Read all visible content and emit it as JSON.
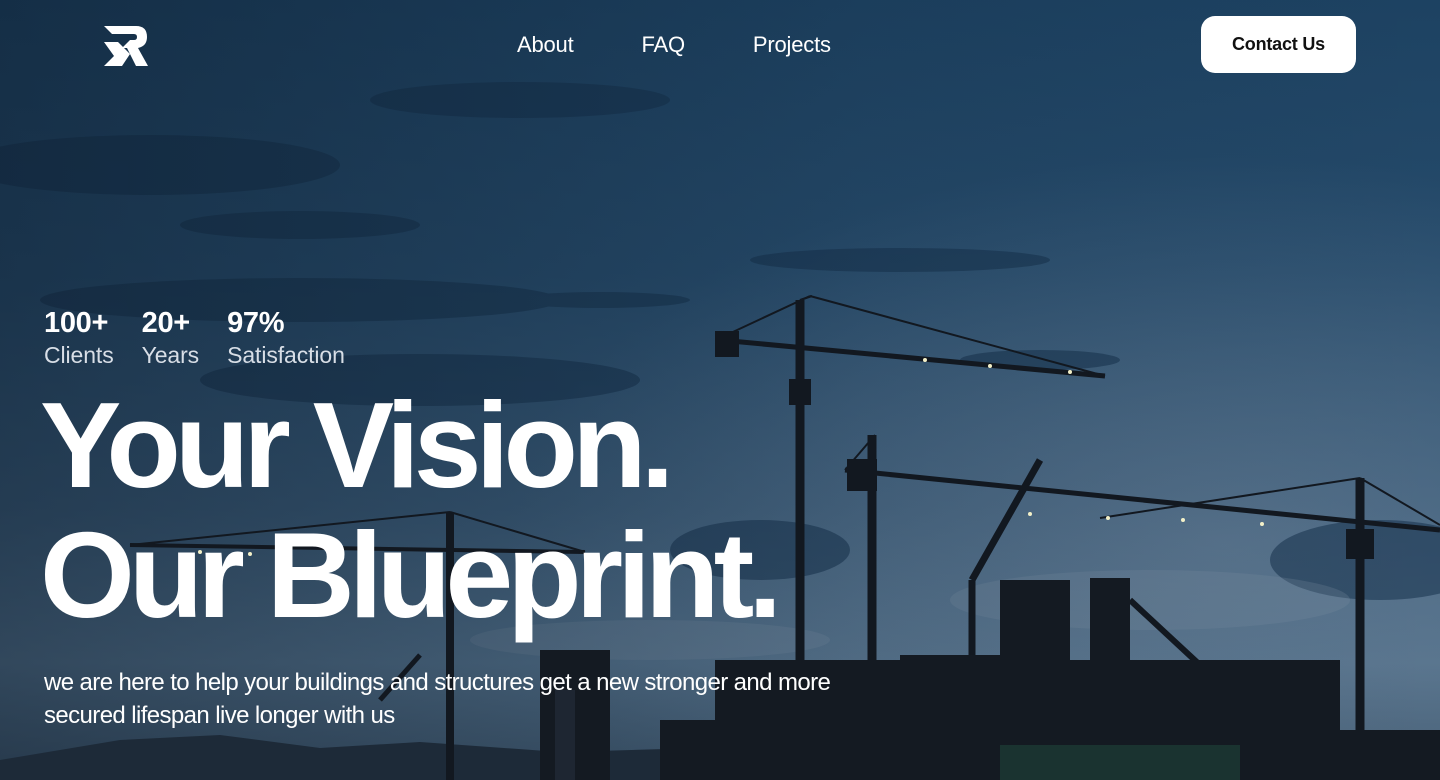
{
  "header": {
    "logo_alt": "SR logo",
    "nav": [
      {
        "label": "About"
      },
      {
        "label": "FAQ"
      },
      {
        "label": "Projects"
      }
    ],
    "cta_label": "Contact Us"
  },
  "stats": [
    {
      "value": "100+",
      "label": "Clients"
    },
    {
      "value": "20+",
      "label": "Years"
    },
    {
      "value": "97%",
      "label": "Satisfaction"
    }
  ],
  "hero": {
    "headline_line1": "Your Vision.",
    "headline_line2": "Our Blueprint.",
    "subtext": "we are here to help your buildings and structures get a new stronger and more secured lifespan live longer with us",
    "background": "construction-cranes-dusk-photo"
  },
  "colors": {
    "sky_top": "#1e4466",
    "sky_mid": "#2b5272",
    "sky_low": "#4a6a85",
    "silhouette": "#141a22",
    "button_bg": "#ffffff",
    "button_text": "#111111"
  }
}
